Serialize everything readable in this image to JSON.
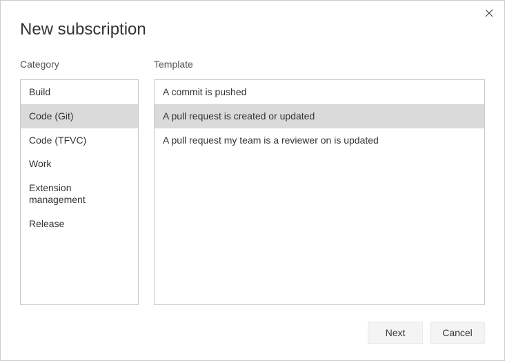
{
  "title": "New subscription",
  "labels": {
    "category": "Category",
    "template": "Template"
  },
  "categories": [
    {
      "label": "Build",
      "selected": false
    },
    {
      "label": "Code (Git)",
      "selected": true
    },
    {
      "label": "Code (TFVC)",
      "selected": false
    },
    {
      "label": "Work",
      "selected": false
    },
    {
      "label": "Extension management",
      "selected": false
    },
    {
      "label": "Release",
      "selected": false
    }
  ],
  "templates": [
    {
      "label": "A commit is pushed",
      "selected": false
    },
    {
      "label": "A pull request is created or updated",
      "selected": true
    },
    {
      "label": "A pull request my team is a reviewer on is updated",
      "selected": false
    }
  ],
  "buttons": {
    "next": "Next",
    "cancel": "Cancel"
  }
}
